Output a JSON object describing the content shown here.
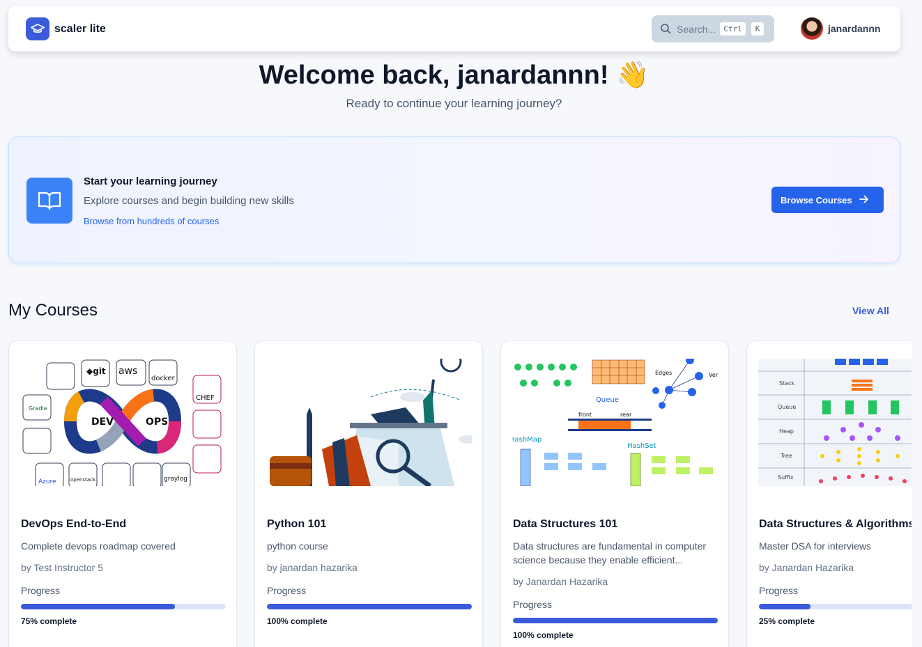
{
  "header": {
    "app_name": "scaler lite",
    "search": {
      "placeholder": "Search...",
      "shortcut_key1": "Ctrl",
      "shortcut_key2": "K"
    },
    "user": {
      "name": "janardannn"
    }
  },
  "welcome": {
    "title": "Welcome back, janardannn! 👋",
    "subtitle": "Ready to continue your learning journey?"
  },
  "journey": {
    "title": "Start your learning journey",
    "description": "Explore courses and begin building new skills",
    "link": "Browse from hundreds of courses",
    "button_label": "Browse Courses"
  },
  "my_courses": {
    "title": "My Courses",
    "view_all": "View All",
    "progress_label": "Progress",
    "courses": [
      {
        "title": "DevOps End-to-End",
        "description": "Complete devops roadmap covered",
        "instructor": "by Test Instructor 5",
        "progress": 75,
        "progress_text": "75% complete",
        "thumbnail_icon": "devops-infinity-diagram"
      },
      {
        "title": "Python 101",
        "description": "python course",
        "instructor": "by janardan hazarika",
        "progress": 100,
        "progress_text": "100% complete",
        "thumbnail_icon": "study-illustration"
      },
      {
        "title": "Data Structures 101",
        "description": "Data structures are fundamental in computer science because they enable efficient...",
        "instructor": "by Janardan Hazarika",
        "progress": 100,
        "progress_text": "100% complete",
        "thumbnail_icon": "data-structures-diagram"
      },
      {
        "title": "Data Structures & Algorithms",
        "description": "Master DSA for interviews",
        "instructor": "by Janardan Hazarika",
        "progress": 25,
        "progress_text": "25% complete",
        "thumbnail_icon": "dsa-table-diagram"
      }
    ]
  },
  "colors": {
    "primary": "#3b5bdb",
    "accent_blue": "#2563eb",
    "page_bg": "#f6f8fb"
  }
}
